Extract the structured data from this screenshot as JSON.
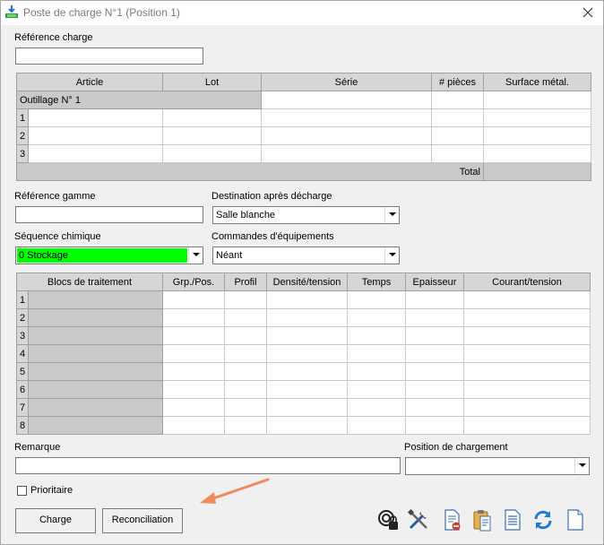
{
  "window": {
    "title": "Poste de charge N°1 (Position 1)"
  },
  "reference_charge": {
    "label": "Référence charge",
    "value": ""
  },
  "parts_table": {
    "headers": [
      "Article",
      "Lot",
      "Série",
      "# pièces",
      "Surface métal."
    ],
    "group_label": "Outillage N° 1",
    "row_numbers": [
      "1",
      "2",
      "3"
    ],
    "total_label": "Total"
  },
  "reference_gamme": {
    "label": "Référence gamme",
    "value": ""
  },
  "destination": {
    "label": "Destination après décharge",
    "value": "Salle blanche"
  },
  "sequence": {
    "label": "Séquence chimique",
    "value": "0 Stockage",
    "color": "#00ff00"
  },
  "commandes": {
    "label": "Commandes d'équipements",
    "value": "Néant"
  },
  "blocs_table": {
    "headers": [
      "Blocs de traitement",
      "Grp./Pos.",
      "Profil",
      "Densité/tension",
      "Temps",
      "Epaisseur",
      "Courant/tension"
    ],
    "row_numbers": [
      "1",
      "2",
      "3",
      "4",
      "5",
      "6",
      "7",
      "8"
    ]
  },
  "remarque": {
    "label": "Remarque",
    "value": ""
  },
  "position_chargement": {
    "label": "Position de chargement",
    "value": ""
  },
  "prioritaire": {
    "label": "Prioritaire",
    "checked": false
  },
  "buttons": {
    "charge": "Charge",
    "reconciliation": "Reconciliation"
  },
  "toolbar_icons": [
    "search-lock-icon",
    "tools-icon",
    "document-delete-icon",
    "clipboard-paste-icon",
    "document-list-icon",
    "refresh-icon",
    "blank-document-icon"
  ],
  "colors": {
    "annotation_arrow": "#f08a5d"
  }
}
